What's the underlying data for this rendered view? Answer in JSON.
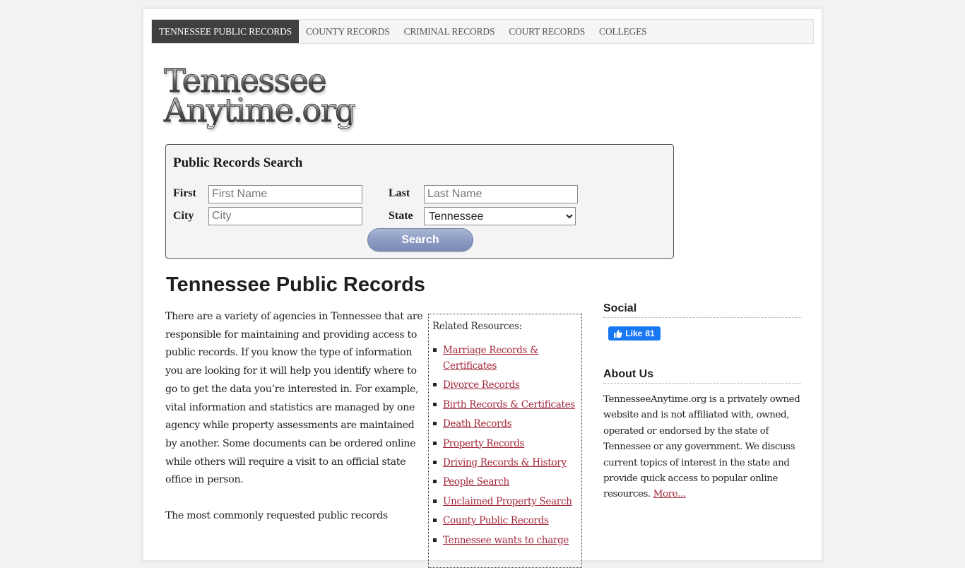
{
  "nav": {
    "items": [
      {
        "label": "TENNESSEE PUBLIC RECORDS",
        "active": true
      },
      {
        "label": "COUNTY RECORDS",
        "active": false
      },
      {
        "label": "CRIMINAL RECORDS",
        "active": false
      },
      {
        "label": "COURT RECORDS",
        "active": false
      },
      {
        "label": "COLLEGES",
        "active": false
      }
    ]
  },
  "logo": {
    "line1": "Tennessee",
    "line2": "Anytime.org"
  },
  "search": {
    "title": "Public Records Search",
    "first_label": "First",
    "first_placeholder": "First Name",
    "last_label": "Last",
    "last_placeholder": "Last Name",
    "city_label": "City",
    "city_placeholder": "City",
    "state_label": "State",
    "state_value": "Tennessee",
    "button_label": "Search"
  },
  "main": {
    "title": "Tennessee Public Records",
    "paragraphs": [
      "There are a variety of agencies in Tennessee that are responsible for maintaining and providing access to public records. If you know the type of information you are looking for it will help you identify where to go to get the data you’re interested in. For example, vital information and statistics are managed by one agency while property assessments are maintained by another. Some documents can be ordered online while others will require a visit to an official state office in person.",
      "The most commonly requested public records"
    ]
  },
  "related": {
    "title": "Related Resources:",
    "links": [
      "Marriage Records & Certificates",
      "Divorce Records",
      "Birth Records & Certificates",
      "Death Records",
      "Property Records",
      "Driving Records & History",
      "People Search",
      "Unclaimed Property Search",
      "County Public Records",
      "Tennessee wants to charge"
    ]
  },
  "sidebar": {
    "social_heading": "Social",
    "like_label": "Like",
    "like_count": "81",
    "about_heading": "About Us",
    "about_text": "TennesseeAnytime.org is a privately owned website and is not affiliated with, owned, operated or endorsed by the state of Tennessee or any government. We discuss current topics of interest in the state and provide quick access to popular online resources.",
    "more_link": "More..."
  },
  "colors": {
    "nav_active_bg": "#3f3f3f",
    "link": "#a3263a",
    "facebook_blue": "#1877f2",
    "search_button": "#8d9dc3"
  }
}
